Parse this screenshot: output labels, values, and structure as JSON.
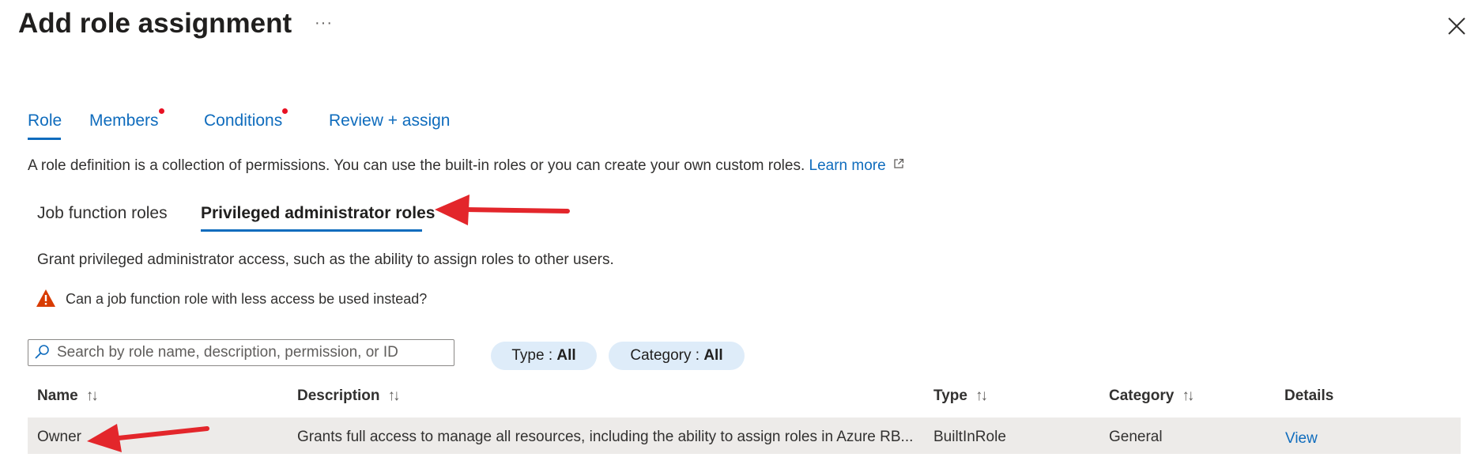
{
  "header": {
    "title": "Add role assignment",
    "more_label": "···"
  },
  "tabs": [
    {
      "label": "Role",
      "active": true,
      "has_dot": false
    },
    {
      "label": "Members",
      "active": false,
      "has_dot": true
    },
    {
      "label": "Conditions",
      "active": false,
      "has_dot": true
    },
    {
      "label": "Review + assign",
      "active": false,
      "has_dot": false
    }
  ],
  "description": {
    "text": "A role definition is a collection of permissions. You can use the built-in roles or you can create your own custom roles.",
    "learn_more": "Learn more"
  },
  "subtabs": {
    "job_function": "Job function roles",
    "privileged": "Privileged administrator roles",
    "active": "privileged"
  },
  "privileged_info": {
    "text": "Grant privileged administrator access, such as the ability to assign roles to other users.",
    "warning": "Can a job function role with less access be used instead?"
  },
  "search": {
    "placeholder": "Search by role name, description, permission, or ID",
    "value": ""
  },
  "filters": [
    {
      "label": "Type : ",
      "value": "All"
    },
    {
      "label": "Category : ",
      "value": "All"
    }
  ],
  "table": {
    "columns": [
      "Name",
      "Description",
      "Type",
      "Category",
      "Details"
    ],
    "rows": [
      {
        "name": "Owner",
        "description": "Grants full access to manage all resources, including the ability to assign roles in Azure RB...",
        "type": "BuiltInRole",
        "category": "General",
        "details": "View"
      }
    ]
  },
  "colors": {
    "accent": "#0f6cbd",
    "notification_dot": "#e81123",
    "warning": "#d83b01",
    "annotation_arrow": "#e3262b",
    "row_highlight": "#edebe9",
    "pill_bg": "#deecf9"
  },
  "icons": [
    "close-icon",
    "search-icon",
    "warning-icon",
    "external-link-icon",
    "sort-icon"
  ]
}
